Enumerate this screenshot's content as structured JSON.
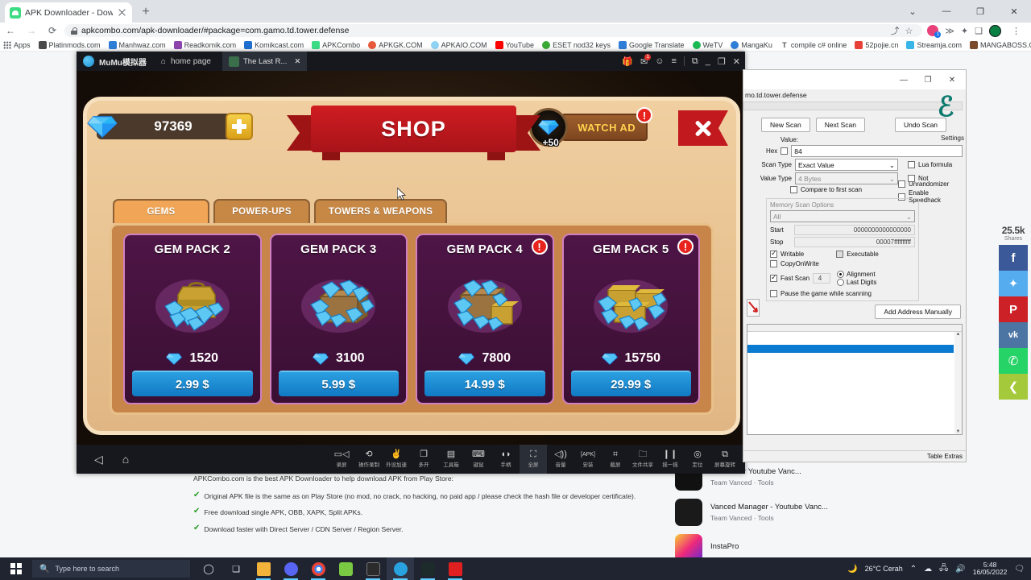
{
  "browser": {
    "tab": {
      "title": "APK Downloader - Download AP",
      "favicon": "android-icon",
      "close": "×"
    },
    "new_tab": "+",
    "window_controls": [
      "⌄",
      "—",
      "❐",
      "✕"
    ],
    "nav": {
      "back": "←",
      "forward": "→",
      "reload": "⟳"
    },
    "omnibox": {
      "lock": "lock-icon",
      "url": "apkcombo.com/apk-downloader/#package=com.gamo.td.tower.defense",
      "share": "⤴",
      "star": "☆"
    },
    "extensions": [
      "ext-pink",
      "ext-blue",
      "puzzle-icon",
      "cast-icon",
      "profile-avatar"
    ],
    "menu": "⋮",
    "bookmarks": [
      {
        "label": "Apps",
        "color": "#cfd3d8"
      },
      {
        "label": "Platinmods.com",
        "color": "#4a4a4a"
      },
      {
        "label": "Manhwaz.com",
        "color": "#2f7ed8"
      },
      {
        "label": "Readkomik.com",
        "color": "#8e44ad"
      },
      {
        "label": "Komikcast.com",
        "color": "#1f6fd0"
      },
      {
        "label": "APKCombo",
        "color": "#3ddc84"
      },
      {
        "label": "APKGK.COM",
        "color": "#e8583a"
      },
      {
        "label": "APKAIO.COM",
        "color": "#8fd3f4"
      },
      {
        "label": "YouTube",
        "color": "#ff0000"
      },
      {
        "label": "ESET nod32 keys",
        "color": "#3aa935"
      },
      {
        "label": "Google Translate",
        "color": "#2f7ed8"
      },
      {
        "label": "WeTV",
        "color": "#1db954"
      },
      {
        "label": "MangaKu",
        "color": "#2f7ed8"
      },
      {
        "label": "compile c# online",
        "color": "#555555"
      },
      {
        "label": "52pojie.cn",
        "color": "#e8413a"
      },
      {
        "label": "Streamja.com",
        "color": "#39b6e8"
      },
      {
        "label": "MANGABOSS.ORG",
        "color": "#7a4a2a"
      }
    ],
    "bookmarks_overflow": "»"
  },
  "page": {
    "lead": "APKCombo.com is the best APK Downloader to help download APK from Play Store:",
    "bullets": [
      "Original APK file is the same as on Play Store (no mod, no crack, no hacking, no paid app / please check the hash file or developer certificate).",
      "Free download single APK, OBB, XAPK, Split APKs.",
      "Download faster with Direct Server / CDN Server / Region Server."
    ],
    "check_glyph": "✔",
    "apps": [
      {
        "name": "MicroG for Youtube Vanc...",
        "sub": "Team Vanced · Tools",
        "color": "#111111"
      },
      {
        "name": "Vanced Manager - Youtube Vanc...",
        "sub": "Team Vanced · Tools",
        "color": "#1a1a1a"
      },
      {
        "name": "InstaPro",
        "sub": "",
        "color": "#d6249f"
      }
    ],
    "share": {
      "count": "25.5k",
      "label": "Shares",
      "buttons": [
        {
          "name": "facebook-share-button",
          "glyph": "f",
          "color": "#3b5998"
        },
        {
          "name": "twitter-share-button",
          "glyph": "🐦",
          "color": "#55acee"
        },
        {
          "name": "pinterest-share-button",
          "glyph": "P",
          "color": "#cc2127"
        },
        {
          "name": "vk-share-button",
          "glyph": "vk",
          "color": "#4c75a3"
        },
        {
          "name": "whatsapp-share-button",
          "glyph": "✆",
          "color": "#25d366"
        },
        {
          "name": "more-share-button",
          "glyph": "<",
          "color": "#a4c93a"
        }
      ]
    }
  },
  "emulator": {
    "brand": "MuMu模拟器",
    "home_tab": "home page",
    "game_tab": "The Last R...",
    "game_tab_close": "✕",
    "titlebar_icons": [
      "gift-icon",
      "inbox-icon",
      "account-icon",
      "menu-icon",
      "restore-icon",
      "minimize-icon",
      "maximize-icon",
      "close-icon"
    ],
    "titlebar_badge": "1",
    "nav_back": "◁",
    "nav_home": "⌂",
    "tools": [
      {
        "icon": "📹",
        "label": "录屏",
        "name": "screen-record-tool"
      },
      {
        "icon": "⟳",
        "label": "操作录制",
        "name": "macro-record-tool"
      },
      {
        "icon": "✋",
        "label": "外设加速",
        "name": "peripheral-boost-tool"
      },
      {
        "icon": "❏",
        "label": "多开",
        "name": "multi-instance-tool"
      },
      {
        "icon": "🧰",
        "label": "工具箱",
        "name": "toolbox-tool"
      },
      {
        "icon": "⌨",
        "label": "键鼠",
        "name": "keyboard-mouse-tool"
      },
      {
        "icon": "🎮",
        "label": "手柄",
        "name": "gamepad-tool"
      },
      {
        "icon": "⛶",
        "label": "全屏",
        "name": "fullscreen-tool"
      },
      {
        "icon": "🔊",
        "label": "音量",
        "name": "volume-tool"
      },
      {
        "icon": "APK",
        "label": "安装",
        "name": "install-apk-tool"
      },
      {
        "icon": "✂",
        "label": "截屏",
        "name": "screenshot-tool"
      },
      {
        "icon": "🗀",
        "label": "文件共享",
        "name": "file-share-tool"
      },
      {
        "icon": "📳",
        "label": "摇一摇",
        "name": "shake-tool"
      },
      {
        "icon": "◎",
        "label": "定位",
        "name": "location-tool"
      },
      {
        "icon": "⎘",
        "label": "屏幕旋转",
        "name": "rotate-screen-tool"
      }
    ]
  },
  "game": {
    "title": "SHOP",
    "gem_balance": "97369",
    "add_gems_glyph": "+",
    "watch_ad": {
      "label": "WATCH AD",
      "reward": "+50",
      "badge": "!"
    },
    "close_glyph": "✕",
    "tabs": [
      {
        "label": "GEMS",
        "active": true
      },
      {
        "label": "POWER-UPS",
        "active": false
      },
      {
        "label": "TOWERS & WEAPONS",
        "active": false
      }
    ],
    "packs": [
      {
        "title": "GEM PACK 2",
        "gems": "1520",
        "price": "2.99 $",
        "badge": "",
        "art": "bag"
      },
      {
        "title": "GEM PACK 3",
        "gems": "3100",
        "price": "5.99 $",
        "badge": "",
        "art": "crate"
      },
      {
        "title": "GEM PACK 4",
        "gems": "7800",
        "price": "14.99 $",
        "badge": "!",
        "art": "crate-bag"
      },
      {
        "title": "GEM PACK 5",
        "gems": "15750",
        "price": "29.99 $",
        "badge": "!",
        "art": "double-bag"
      }
    ]
  },
  "cheat_engine": {
    "window_controls": [
      "—",
      "❐",
      "✕"
    ],
    "process": "mo.td.tower.defense",
    "logo": "cheat-engine-logo",
    "settings_label": "Settings",
    "buttons": {
      "new_scan": "New Scan",
      "next_scan": "Next Scan",
      "undo_scan": "Undo Scan"
    },
    "value_label": "Value:",
    "hex_label": "Hex",
    "hex_checked": false,
    "value": "84",
    "scan_type_label": "Scan Type",
    "scan_type": "Exact Value",
    "value_type_label": "Value Type",
    "value_type": "4 Bytes",
    "compare_first_scan": "Compare to first scan",
    "lua_formula": "Lua formula",
    "not_label": "Not",
    "unrandomizer": "Unrandomizer",
    "enable_speedhack": "Enable Speedhack",
    "memory_scan_options": "Memory Scan Options",
    "region": "All",
    "start_label": "Start",
    "start_value": "0000000000000000",
    "stop_label": "Stop",
    "stop_value": "00007ffffffffff",
    "writable": "Writable",
    "writable_checked": true,
    "executable": "Executable",
    "copyonwrite": "CopyOnWrite",
    "fast_scan": "Fast Scan",
    "fast_scan_checked": true,
    "fast_scan_value": "4",
    "alignment": "Alignment",
    "last_digits": "Last Digits",
    "pause_while_scanning": "Pause the game while scanning",
    "add_address_manually": "Add Address Manually",
    "table_extras": "Table Extras"
  },
  "taskbar": {
    "start": "start-button",
    "search_placeholder": "Type here to search",
    "apps": [
      {
        "name": "cortana-icon",
        "color": "#1f2430",
        "glyph": "◯",
        "active": false,
        "open": false
      },
      {
        "name": "task-view-icon",
        "color": "#1f2430",
        "glyph": "❏",
        "active": false,
        "open": false
      },
      {
        "name": "file-explorer-icon",
        "color": "#f3b23a",
        "glyph": "",
        "active": false,
        "open": true
      },
      {
        "name": "discord-icon",
        "color": "#5865f2",
        "glyph": "",
        "active": false,
        "open": true
      },
      {
        "name": "chrome-icon",
        "color": "#4285f4",
        "glyph": "",
        "active": false,
        "open": true
      },
      {
        "name": "notepad-icon",
        "color": "#7ac943",
        "glyph": "",
        "active": false,
        "open": false
      },
      {
        "name": "terminal-icon",
        "color": "#2b2b2b",
        "glyph": "",
        "active": false,
        "open": true
      },
      {
        "name": "mumu-icon",
        "color": "#29a3e0",
        "glyph": "",
        "active": true,
        "open": true
      },
      {
        "name": "cheat-engine-icon",
        "color": "#1d2b2a",
        "glyph": "",
        "active": false,
        "open": true
      },
      {
        "name": "cheat-engine-c-icon",
        "color": "#e02020",
        "glyph": "",
        "active": false,
        "open": true
      }
    ],
    "weather_icon": "🌙",
    "weather": "26°C  Cerah",
    "chevron": "⌃",
    "tray_icons": [
      "☂",
      "🖧",
      "🔊"
    ],
    "time": "5:48",
    "date": "16/05/2022",
    "notification": "🗨"
  }
}
